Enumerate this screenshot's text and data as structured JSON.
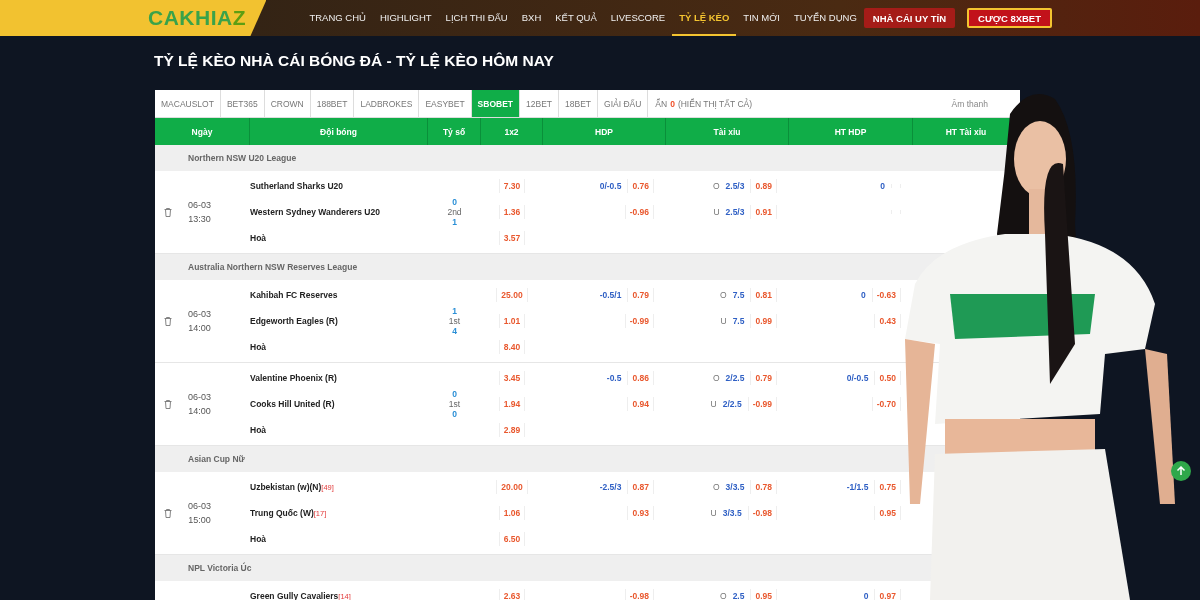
{
  "header": {
    "logo": {
      "main": "CAKHIA",
      "accent": "Z"
    },
    "nav": [
      {
        "label": "TRANG CHỦ",
        "selected": false
      },
      {
        "label": "HIGHLIGHT",
        "selected": false
      },
      {
        "label": "LỊCH THI ĐẤU",
        "selected": false
      },
      {
        "label": "BXH",
        "selected": false
      },
      {
        "label": "KẾT QUẢ",
        "selected": false
      },
      {
        "label": "LIVESCORE",
        "selected": false
      },
      {
        "label": "TỶ LỆ KÈO",
        "selected": true
      },
      {
        "label": "TIN MỚI",
        "selected": false
      },
      {
        "label": "TUYỂN DỤNG",
        "selected": false
      }
    ],
    "buttons": [
      {
        "label": "NHÀ CÁI UY TÍN",
        "kind": "plain"
      },
      {
        "label": "CƯỢC 8XBET",
        "kind": "outlined"
      }
    ]
  },
  "page_title": "TỶ LỆ KÈO NHÀ CÁI BÓNG ĐÁ - TỶ LỆ KÈO HÔM NAY",
  "bookmaker_tabs": [
    {
      "label": "MACAUSLOT",
      "selected": false
    },
    {
      "label": "BET365",
      "selected": false
    },
    {
      "label": "CROWN",
      "selected": false
    },
    {
      "label": "188BET",
      "selected": false
    },
    {
      "label": "LADBROKES",
      "selected": false
    },
    {
      "label": "EASYBET",
      "selected": false
    },
    {
      "label": "SBOBET",
      "selected": true
    },
    {
      "label": "12BET",
      "selected": false
    },
    {
      "label": "18BET",
      "selected": false
    },
    {
      "label": "GIẢI ĐẤU",
      "selected": false
    }
  ],
  "hidden_filter": {
    "label": "ẨN",
    "count": "0",
    "link": "(HIỂN THỊ TẤT CẢ)"
  },
  "sound_toggle": "Âm thanh",
  "table": {
    "columns": [
      "Ngày",
      "Đội bóng",
      "Tỷ số",
      "1x2",
      "HDP",
      "Tài xỉu",
      "HT HDP",
      "HT Tài xỉu"
    ],
    "leagues": [
      {
        "name": "Northern NSW U20 League",
        "matches": [
          {
            "date": "06-03",
            "time": "13:30",
            "score": {
              "home": "0",
              "period": "2nd",
              "away": "1"
            },
            "rows": [
              {
                "team": "Sutherland Sharks U20",
                "x12": "7.30",
                "hdp": {
                  "line": "0/-0.5",
                  "odds": "0.76"
                },
                "ou": {
                  "side": "O",
                  "line": "2.5/3",
                  "odds": "0.89"
                },
                "ht_hdp": {
                  "line": "0"
                }
              },
              {
                "team": "Western Sydney Wanderers U20",
                "x12": "1.36",
                "hdp": {
                  "odds": "-0.96"
                },
                "ou": {
                  "side": "U",
                  "line": "2.5/3",
                  "odds": "0.91"
                },
                "ht_hdp": {}
              },
              {
                "team": "Hoà",
                "x12": "3.57"
              }
            ]
          }
        ]
      },
      {
        "name": "Australia Northern NSW Reserves League",
        "matches": [
          {
            "date": "06-03",
            "time": "14:00",
            "score": {
              "home": "1",
              "period": "1st",
              "away": "4"
            },
            "rows": [
              {
                "team": "Kahibah FC Reserves",
                "x12": "25.00",
                "hdp": {
                  "line": "-0.5/1",
                  "odds": "0.79"
                },
                "ou": {
                  "side": "O",
                  "line": "7.5",
                  "odds": "0.81"
                },
                "ht_hdp": {
                  "line": "0",
                  "odds": "-0.63"
                }
              },
              {
                "team": "Edgeworth Eagles (R)",
                "x12": "1.01",
                "hdp": {
                  "odds": "-0.99"
                },
                "ou": {
                  "side": "U",
                  "line": "7.5",
                  "odds": "0.99"
                },
                "ht_hdp": {
                  "odds": "0.43"
                }
              },
              {
                "team": "Hoà",
                "x12": "8.40"
              }
            ]
          },
          {
            "date": "06-03",
            "time": "14:00",
            "score": {
              "home": "0",
              "period": "1st",
              "away": "0"
            },
            "rows": [
              {
                "team": "Valentine Phoenix (R)",
                "x12": "3.45",
                "hdp": {
                  "line": "-0.5",
                  "odds": "0.86"
                },
                "ou": {
                  "side": "O",
                  "line": "2/2.5",
                  "odds": "0.79"
                },
                "ht_hdp": {
                  "line": "0/-0.5",
                  "odds": "0.50"
                }
              },
              {
                "team": "Cooks Hill United (R)",
                "x12": "1.94",
                "hdp": {
                  "odds": "0.94"
                },
                "ou": {
                  "side": "U",
                  "line": "2/2.5",
                  "odds": "-0.99"
                },
                "ht_hdp": {
                  "odds": "-0.70"
                }
              },
              {
                "team": "Hoà",
                "x12": "2.89"
              }
            ]
          }
        ]
      },
      {
        "name": "Asian Cup Nữ",
        "matches": [
          {
            "date": "06-03",
            "time": "15:00",
            "rows": [
              {
                "team": "Uzbekistan (w)(N)",
                "rank": "[49]",
                "x12": "20.00",
                "hdp": {
                  "line": "-2.5/3",
                  "odds": "0.87"
                },
                "ou": {
                  "side": "O",
                  "line": "3/3.5",
                  "odds": "0.78"
                },
                "ht_hdp": {
                  "line": "-1/1.5",
                  "odds": "0.75"
                }
              },
              {
                "team": "Trung Quốc (W)",
                "rank": "[17]",
                "x12": "1.06",
                "hdp": {
                  "odds": "0.93"
                },
                "ou": {
                  "side": "U",
                  "line": "3/3.5",
                  "odds": "-0.98"
                },
                "ht_hdp": {
                  "odds": "0.95"
                }
              },
              {
                "team": "Hoà",
                "x12": "6.50"
              }
            ]
          }
        ]
      },
      {
        "name": "NPL Victoria Úc",
        "matches": [
          {
            "rows": [
              {
                "team": "Green Gully Cavaliers",
                "rank": "[14]",
                "x12": "2.63",
                "hdp": {
                  "odds": "-0.98"
                },
                "ou": {
                  "side": "O",
                  "line": "2.5",
                  "odds": "0.95"
                },
                "ht_hdp": {
                  "line": "0",
                  "odds": "0.97"
                }
              }
            ]
          }
        ]
      }
    ]
  }
}
